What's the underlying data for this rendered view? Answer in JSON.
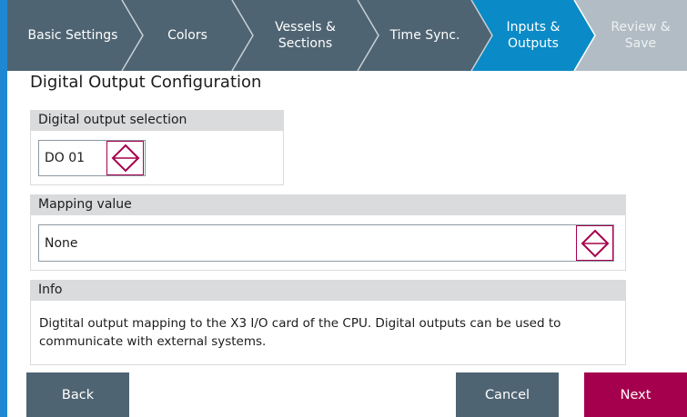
{
  "wizard": {
    "steps": [
      {
        "label": "Basic Settings",
        "state": "done"
      },
      {
        "label": "Colors",
        "state": "done"
      },
      {
        "label": "Vessels &\nSections",
        "state": "done"
      },
      {
        "label": "Time Sync.",
        "state": "done"
      },
      {
        "label": "Inputs &\nOutputs",
        "state": "active"
      },
      {
        "label": "Review &\nSave",
        "state": "pending"
      }
    ]
  },
  "page": {
    "title": "Digital Output Configuration"
  },
  "digital_output": {
    "header": "Digital output selection",
    "value": "DO 01"
  },
  "mapping": {
    "header": "Mapping value",
    "value": "None"
  },
  "info": {
    "header": "Info",
    "text": "Digtital output mapping to the X3 I/O card of the CPU. Digital outputs can be used to communicate with external systems."
  },
  "footer": {
    "back_label": "Back",
    "cancel_label": "Cancel",
    "next_label": "Next"
  },
  "colors": {
    "wizard_done": "#4f6472",
    "wizard_active": "#0a8ac6",
    "wizard_pending": "#b1bcc4",
    "accent": "#a5004d",
    "left_strip": "#1e88d2",
    "button_gray": "#4f6472"
  }
}
